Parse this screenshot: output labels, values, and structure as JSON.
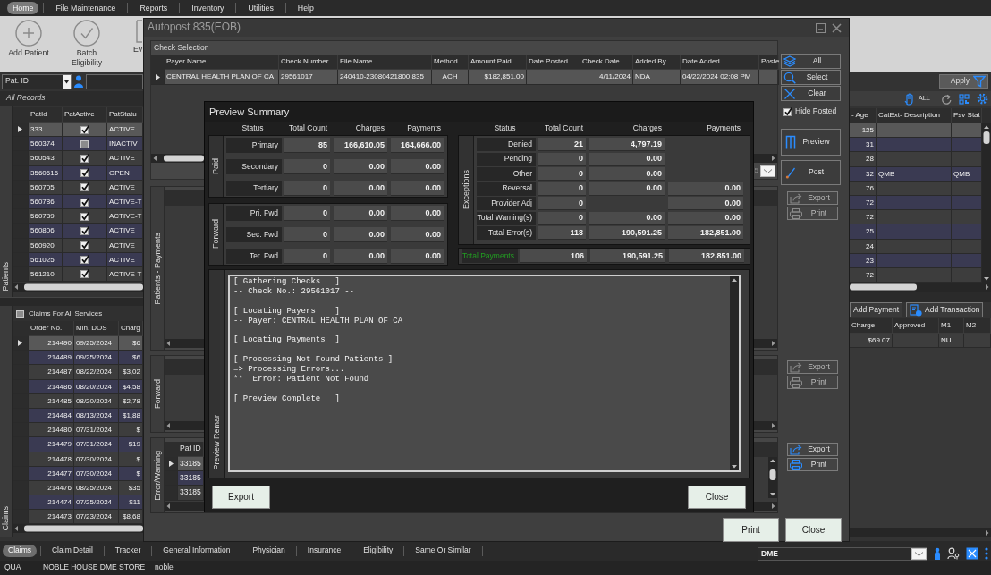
{
  "menu": [
    {
      "label": "Home",
      "selected": true
    },
    {
      "label": "File Maintenance",
      "selected": false
    },
    {
      "label": "Reports",
      "selected": false
    },
    {
      "label": "Inventory",
      "selected": false
    },
    {
      "label": "Utilities",
      "selected": false
    },
    {
      "label": "Help",
      "selected": false
    }
  ],
  "ribbon": [
    {
      "label": "Add Patient",
      "kind": "add"
    },
    {
      "label": "Batch Eligibility",
      "kind": "check"
    },
    {
      "label": "Ev",
      "kind": "document"
    }
  ],
  "patient_search": {
    "field": "Pat. ID"
  },
  "patients": {
    "title": "All Records",
    "side_label": "Patients",
    "columns": [
      "PatId",
      "PatActive",
      "PatStatu",
      "- Age",
      "CatExt- Description",
      "Psv Stat"
    ],
    "rows": [
      {
        "id": "333",
        "active": true,
        "status": "ACTIVE",
        "age": "125",
        "selected": true
      },
      {
        "id": "560374",
        "active": false,
        "status": "INACTIV",
        "age": "31",
        "selected": false
      },
      {
        "id": "560543",
        "active": true,
        "status": "ACTIVE",
        "age": "28",
        "selected": false
      },
      {
        "id": "3560616",
        "active": true,
        "status": "OPEN",
        "age": "32",
        "description": "QMB",
        "psv_status": "QMB",
        "selected": false
      },
      {
        "id": "560705",
        "active": true,
        "status": "ACTIVE",
        "age": "76",
        "selected": false
      },
      {
        "id": "560786",
        "active": true,
        "status": "ACTIVE-T",
        "age": "72",
        "selected": false
      },
      {
        "id": "560789",
        "active": true,
        "status": "ACTIVE-T",
        "age": "72",
        "selected": false
      },
      {
        "id": "560806",
        "active": true,
        "status": "ACTIVE",
        "age": "25",
        "selected": false
      },
      {
        "id": "560920",
        "active": true,
        "status": "ACTIVE",
        "age": "24",
        "selected": false
      },
      {
        "id": "561025",
        "active": true,
        "status": "ACTIVE",
        "age": "23",
        "selected": false
      },
      {
        "id": "561210",
        "active": true,
        "status": "ACTIVE-T",
        "age": "72",
        "selected": false
      }
    ]
  },
  "grid_toolbar": {
    "apply": "Apply",
    "filter_label": "ALL"
  },
  "claims": {
    "title": "Claims For All Services",
    "checked": false,
    "side_label": "Claims",
    "columns": [
      "Order No.",
      "Min. DOS",
      "Charg"
    ],
    "rows": [
      {
        "order": "214490",
        "dos": "09/25/2024",
        "charge": "$6",
        "selected": true
      },
      {
        "order": "214489",
        "dos": "09/25/2024",
        "charge": "$6",
        "selected": false
      },
      {
        "order": "214487",
        "dos": "08/22/2024",
        "charge": "$3,02",
        "selected": false
      },
      {
        "order": "214486",
        "dos": "08/20/2024",
        "charge": "$4,58",
        "selected": false
      },
      {
        "order": "214485",
        "dos": "08/20/2024",
        "charge": "$2,78",
        "selected": false
      },
      {
        "order": "214484",
        "dos": "08/13/2024",
        "charge": "$1,88",
        "selected": false
      },
      {
        "order": "214480",
        "dos": "07/31/2024",
        "charge": "$",
        "selected": false
      },
      {
        "order": "214479",
        "dos": "07/31/2024",
        "charge": "$19",
        "selected": false
      },
      {
        "order": "214478",
        "dos": "07/30/2024",
        "charge": "$",
        "selected": false
      },
      {
        "order": "214477",
        "dos": "07/30/2024",
        "charge": "$",
        "selected": false
      },
      {
        "order": "214476",
        "dos": "08/25/2024",
        "charge": "$35",
        "selected": false
      },
      {
        "order": "214474",
        "dos": "07/25/2024",
        "charge": "$11",
        "selected": false
      },
      {
        "order": "214473",
        "dos": "07/23/2024",
        "charge": "$8,68",
        "selected": false
      }
    ]
  },
  "ledger_buttons": [
    {
      "label": "Add Payment",
      "kind": "plain"
    },
    {
      "label": "Add Transaction",
      "kind": "transaction"
    }
  ],
  "service_lines": {
    "columns": [
      "Charge",
      "Approved",
      "M1",
      "M2"
    ],
    "rows": [
      {
        "charge": "$69.07",
        "m1": "NU"
      }
    ]
  },
  "bottom_tabs": [
    {
      "label": "Claims",
      "selected": true
    },
    {
      "label": "Claim Detail",
      "selected": false
    },
    {
      "label": "Tracker",
      "selected": false
    },
    {
      "label": "General Information",
      "selected": false
    },
    {
      "label": "Physician",
      "selected": false
    },
    {
      "label": "Insurance",
      "selected": false
    },
    {
      "label": "Eligibility",
      "selected": false
    },
    {
      "label": "Same Or Similar",
      "selected": false
    }
  ],
  "location_field": {
    "value": "DME"
  },
  "status_bar": [
    "QUA",
    "NOBLE HOUSE DME STORE",
    "noble"
  ],
  "autopost": {
    "title": "Autopost 835(EOB)",
    "check_selection": {
      "title": "Check Selection",
      "columns": [
        "Payer Name",
        "Check Number",
        "File Name",
        "Method",
        "Amount Paid",
        "Date Posted",
        "Check Date",
        "Added By",
        "Date Added",
        "Poste"
      ],
      "rows": [
        {
          "payer_name": "CENTRAL HEALTH PLAN OF CA",
          "check_number": "29561017",
          "file_name": "240410-23080421800.835",
          "method": "ACH",
          "amount_paid": "$182,851.00",
          "check_date": "4/11/2024",
          "added_by": "NDA",
          "date_added": "04/22/2024 02:08 PM",
          "selected": true
        }
      ],
      "pager": "5"
    },
    "selection_buttons": [
      {
        "label": "All",
        "kind": "all"
      },
      {
        "label": "Select",
        "kind": "select"
      },
      {
        "label": "Clear",
        "kind": "clear"
      }
    ],
    "hide_posted": {
      "label": "Hide Posted",
      "checked": true
    },
    "action_buttons": [
      {
        "label": "Preview",
        "kind": "preview"
      },
      {
        "label": "Post",
        "kind": "post"
      }
    ],
    "panels": [
      {
        "label": "Patients - Payments",
        "buttons": [
          {
            "label": "Export",
            "kind": "export",
            "disabled": true
          },
          {
            "label": "Print",
            "kind": "print",
            "disabled": true
          }
        ]
      },
      {
        "label": "Forward",
        "buttons": [
          {
            "label": "Export",
            "kind": "export",
            "disabled": true
          },
          {
            "label": "Print",
            "kind": "print",
            "disabled": true
          }
        ]
      },
      {
        "label": "Error/Warning",
        "columns": [
          "Pat ID"
        ],
        "rows": [
          {
            "pat_id": "33185",
            "selected": true
          },
          {
            "pat_id": "33185",
            "selected": false
          },
          {
            "pat_id": "33185",
            "selected": false
          }
        ],
        "buttons": [
          {
            "label": "Export",
            "kind": "export",
            "disabled": false
          },
          {
            "label": "Print",
            "kind": "print",
            "disabled": false
          }
        ]
      }
    ],
    "footer_buttons": [
      "Print",
      "Close"
    ]
  },
  "preview_summary": {
    "title": "Preview Summary",
    "left_columns": [
      "Status",
      "Total Count",
      "Charges",
      "Payments"
    ],
    "groups": [
      {
        "label": "Paid",
        "rows": [
          {
            "status": "Primary",
            "count": "85",
            "charges": "166,610.05",
            "payments": "164,666.00"
          },
          {
            "status": "Secondary",
            "count": "0",
            "charges": "0.00",
            "payments": "0.00"
          },
          {
            "status": "Tertiary",
            "count": "0",
            "charges": "0.00",
            "payments": "0.00"
          }
        ]
      },
      {
        "label": "Forward",
        "rows": [
          {
            "status": "Pri. Fwd",
            "count": "0",
            "charges": "0.00",
            "payments": "0.00"
          },
          {
            "status": "Sec. Fwd",
            "count": "0",
            "charges": "0.00",
            "payments": "0.00"
          },
          {
            "status": "Ter. Fwd",
            "count": "0",
            "charges": "0.00",
            "payments": "0.00"
          }
        ]
      }
    ],
    "right_columns": [
      "Status",
      "Total Count",
      "Charges",
      "Payments"
    ],
    "exceptions": {
      "label": "Exceptions",
      "rows": [
        {
          "status": "Denied",
          "count": "21",
          "charges": "4,797.19"
        },
        {
          "status": "Pending",
          "count": "0",
          "charges": "0.00"
        },
        {
          "status": "Other",
          "count": "0",
          "charges": "0.00"
        },
        {
          "status": "Reversal",
          "count": "0",
          "charges": "0.00",
          "payments": "0.00"
        },
        {
          "status": "Provider Adj",
          "count": "0",
          "payments": "0.00"
        },
        {
          "status": "Total Warning(s)",
          "count": "0",
          "charges": "0.00",
          "payments": "0.00"
        },
        {
          "status": "Total Error(s)",
          "count": "118",
          "charges": "190,591.25",
          "payments": "182,851.00"
        }
      ]
    },
    "total": {
      "status": "Total Payments",
      "count": "106",
      "charges": "190,591.25",
      "payments": "182,851.00"
    },
    "remarks": {
      "label": "Preview Remar",
      "text": "[ Gathering Checks   ]\n-- Check No.: 29561017 --\n\n[ Locating Payers    ]\n-- Payer: CENTRAL HEALTH PLAN OF CA\n\n[ Locating Payments  ]\n\n[ Processing Not Found Patients ]\n=> Processing Errors...\n**  Error: Patient Not Found\n\n[ Preview Complete   ]"
    },
    "buttons": [
      "Export",
      "Close"
    ]
  }
}
